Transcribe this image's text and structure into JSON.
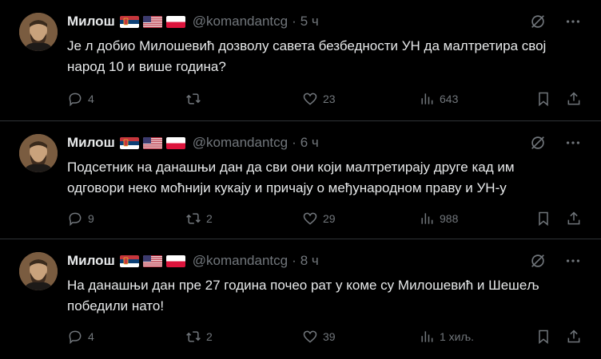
{
  "tweets": [
    {
      "name": "Милош",
      "handle": "@komandantcg",
      "separator": "·",
      "time": "5 ч",
      "text_line1": "Је л добио Милошевић дозволу савета безбедности УН да малтретира свој",
      "text_line2": "народ 10 и више година?",
      "replies": "4",
      "retweets": "",
      "likes": "23",
      "views": "643"
    },
    {
      "name": "Милош",
      "handle": "@komandantcg",
      "separator": "·",
      "time": "6 ч",
      "text_line1": "Подсетник на данашњи дан да сви они који малтретирају друге кад им",
      "text_line2": "одговори неко моћнији кукају и причају о међународном праву и УН-у",
      "replies": "9",
      "retweets": "2",
      "likes": "29",
      "views": "988"
    },
    {
      "name": "Милош",
      "handle": "@komandantcg",
      "separator": "·",
      "time": "8 ч",
      "text_line1": "На данашњи дан пре 27 година почео рат у коме су Милошевић и Шешељ",
      "text_line2": "победили нато!",
      "replies": "4",
      "retweets": "2",
      "likes": "39",
      "views": "1 хиљ."
    }
  ],
  "flags": [
    "serbia-flag",
    "usa-flag",
    "poland-flag"
  ],
  "colors": {
    "background": "#000000",
    "text": "#e7e9ea",
    "muted": "#71767b",
    "divider": "#2f3336"
  }
}
